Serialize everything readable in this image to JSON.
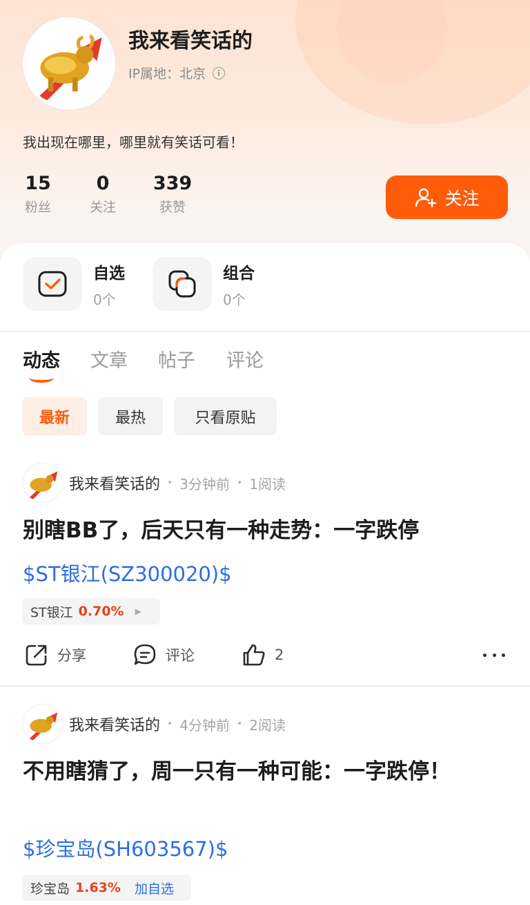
{
  "profile": {
    "username": "我来看笑话的",
    "ip_location": "IP属地：北京",
    "bio": "我出现在哪里，哪里就有笑话可看！",
    "stats": [
      {
        "value": "15",
        "label": "粉丝"
      },
      {
        "value": "0",
        "label": "关注"
      },
      {
        "value": "339",
        "label": "获赞"
      }
    ],
    "follow_label": "关注"
  },
  "tools": [
    {
      "title": "自选",
      "count": "0个",
      "icon": "checklist-icon"
    },
    {
      "title": "组合",
      "count": "0个",
      "icon": "portfolio-icon"
    }
  ],
  "tabs": [
    "动态",
    "文章",
    "帖子",
    "评论"
  ],
  "active_tab": "动态",
  "filters": [
    "最新",
    "最热",
    "只看原贴"
  ],
  "active_filter": "最新",
  "posts": [
    {
      "author": "我来看笑话的",
      "time": "3分钟前",
      "reads": "1阅读",
      "title": "别瞎BB了，后天只有一种走势：一字跌停",
      "stock_tag": "$ST银江(SZ300020)$",
      "chip_name": "ST银江",
      "chip_change": "0.70%",
      "actions": {
        "share": "分享",
        "comment": "评论",
        "likes": "2"
      }
    },
    {
      "author": "我来看笑话的",
      "time": "4分钟前",
      "reads": "2阅读",
      "title": "不用瞎猜了，周一只有一种可能：一字跌停！",
      "stock_tag": "$珍宝岛(SH603567)$",
      "chip_name": "珍宝岛",
      "chip_change": "1.63%",
      "chip_action": "加自选"
    }
  ],
  "colors": {
    "accent": "#ff5c0a",
    "link": "#2c6fe0",
    "change": "#e8411a"
  }
}
